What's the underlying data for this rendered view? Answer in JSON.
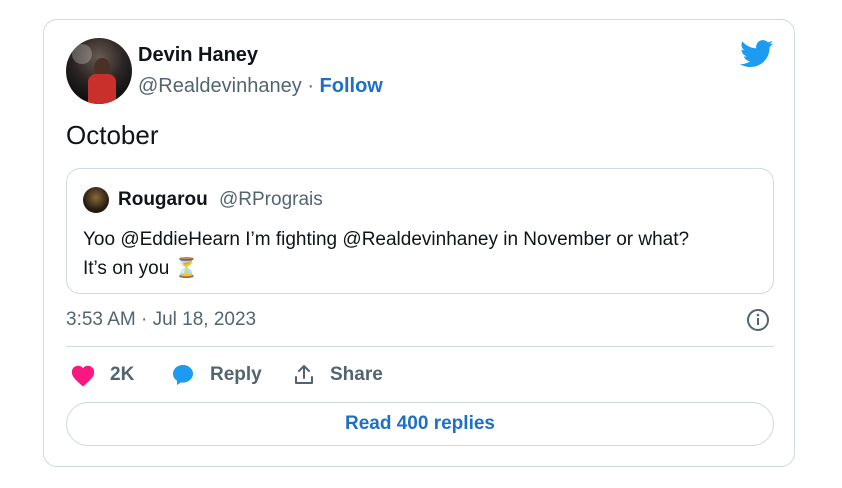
{
  "author": {
    "name": "Devin Haney",
    "handle": "@Realdevinhaney",
    "separator": "·",
    "follow_label": "Follow"
  },
  "tweet": {
    "text": "October",
    "timestamp": "3:53 AM · Jul 18, 2023"
  },
  "quoted": {
    "name": "Rougarou",
    "handle": "@RPrograis",
    "text_line1": "Yoo @EddieHearn I’m fighting @Realdevinhaney in November or what?",
    "text_line2": "It’s on you ⏳"
  },
  "actions": {
    "likes": "2K",
    "reply_label": "Reply",
    "share_label": "Share"
  },
  "read_replies_label": "Read 400 replies",
  "colors": {
    "twitter_blue": "#1d9bf0",
    "link_blue": "#1d6fc8",
    "heart_pink": "#f91880",
    "muted_text": "#536471",
    "border": "#cfd9de"
  },
  "icons": [
    "twitter-logo-icon",
    "info-icon",
    "heart-icon",
    "reply-bubble-icon",
    "share-icon",
    "hourglass-emoji"
  ]
}
